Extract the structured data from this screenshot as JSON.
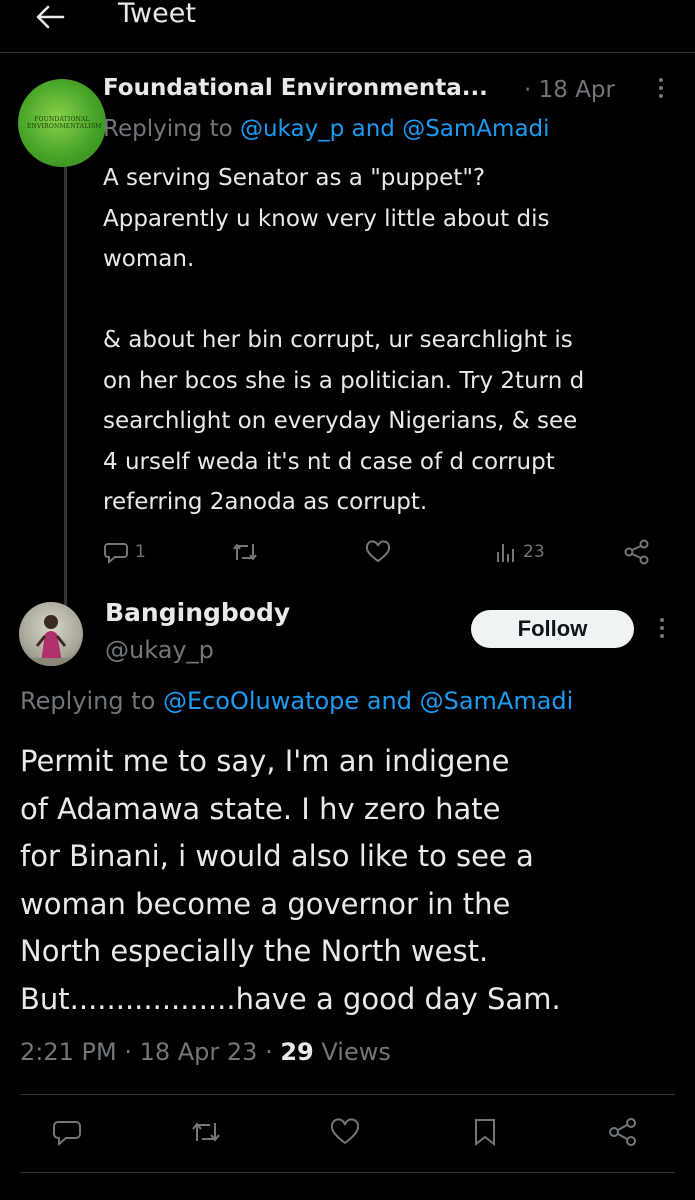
{
  "header": {
    "title": "Tweet"
  },
  "tweet1": {
    "name": "Foundational Environmenta...",
    "time": "· 18 Apr",
    "replying_prefix": "Replying to ",
    "mention1": "@ukay_p",
    "and": " and ",
    "mention2": "@SamAmadi",
    "text": "A serving Senator as a \"puppet\"?\nApparently u know very little about dis\nwoman.\n\n& about her bin corrupt, ur searchlight is\non her bcos she is a politician. Try 2turn d\nsearchlight on everyday Nigerians, & see\n4 urself weda it's nt d case of d corrupt\nreferring 2anoda as corrupt.",
    "avatar_text": "FOUNDATIONAL ENVIRONMENTALISM",
    "reply_count": "1",
    "retweet_count": "",
    "like_count": "",
    "views_count": "23"
  },
  "tweet2": {
    "name": "Bangingbody",
    "handle": "@ukay_p",
    "follow_label": "Follow",
    "replying_prefix": "Replying to ",
    "mention1": "@EcoOluwatope",
    "and": " and ",
    "mention2": "@SamAmadi",
    "text": "Permit me to say, I'm an indigene\nof Adamawa state. I hv zero hate\nfor Binani, i would also like to see a\nwoman become a governor in the\nNorth especially the North west.\nBut..................have a good day Sam.",
    "time": "2:21 PM · 18 Apr 23 · ",
    "views_number": "29",
    "views_label": " Views"
  },
  "icons": {
    "back": "arrow-left-icon",
    "reply": "reply-icon",
    "retweet": "retweet-icon",
    "like": "heart-icon",
    "views": "views-icon",
    "share": "share-icon",
    "bookmark": "bookmark-icon",
    "more": "more-vertical-icon"
  },
  "colors": {
    "background": "#000000",
    "text": "#e7e9ea",
    "muted": "#71767b",
    "link": "#1d9bf0",
    "divider": "#2f3336"
  }
}
